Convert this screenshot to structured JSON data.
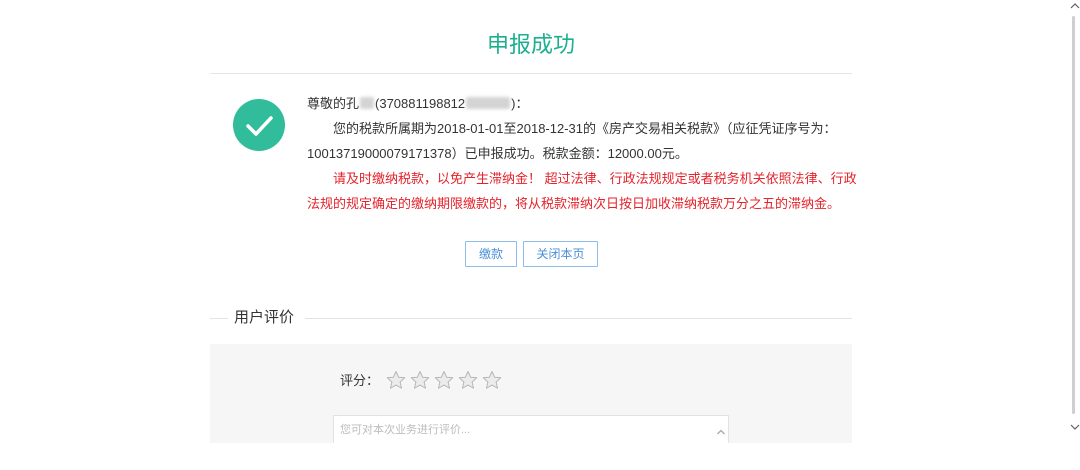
{
  "page": {
    "title": "申报成功"
  },
  "notice": {
    "greeting": {
      "prefix": "尊敬的孔",
      "id_visible": "(370881198812",
      "suffix": ")："
    },
    "result_lines": [
      "您的税款所属期为2018-01-01至2018-12-31的《房产交易相关税款》（应征凭证序号为：",
      "10013719000079171378）已申报成功。税款金额：12000.00元。"
    ],
    "warning_lines": [
      "请及时缴纳税款，以免产生滞纳金！ 超过法律、行政法规规定或者税务机关依照法律、行政",
      "法规的规定确定的缴纳期限缴款的，将从税款滞纳次日按日加收滞纳税款万分之五的滞纳金。"
    ]
  },
  "actions": {
    "pay_label": "缴款",
    "close_label": "关闭本页"
  },
  "rating": {
    "section_title": "用户评价",
    "score_label": "评分：",
    "stars_total": 5,
    "stars_selected": 0,
    "comment_placeholder": "您可对本次业务进行评价..."
  },
  "colors": {
    "accent": "#1db08f",
    "success_circle": "#31bc9b",
    "warning_text": "#e4232b",
    "button_text": "#4b8fd6",
    "button_border": "#8dbde8",
    "panel_bg": "#f6f6f6"
  },
  "icons": {
    "success": "check-circle-icon",
    "star": "star-icon",
    "scroll_up": "chevron-up-icon",
    "scroll_down": "chevron-down-icon"
  }
}
